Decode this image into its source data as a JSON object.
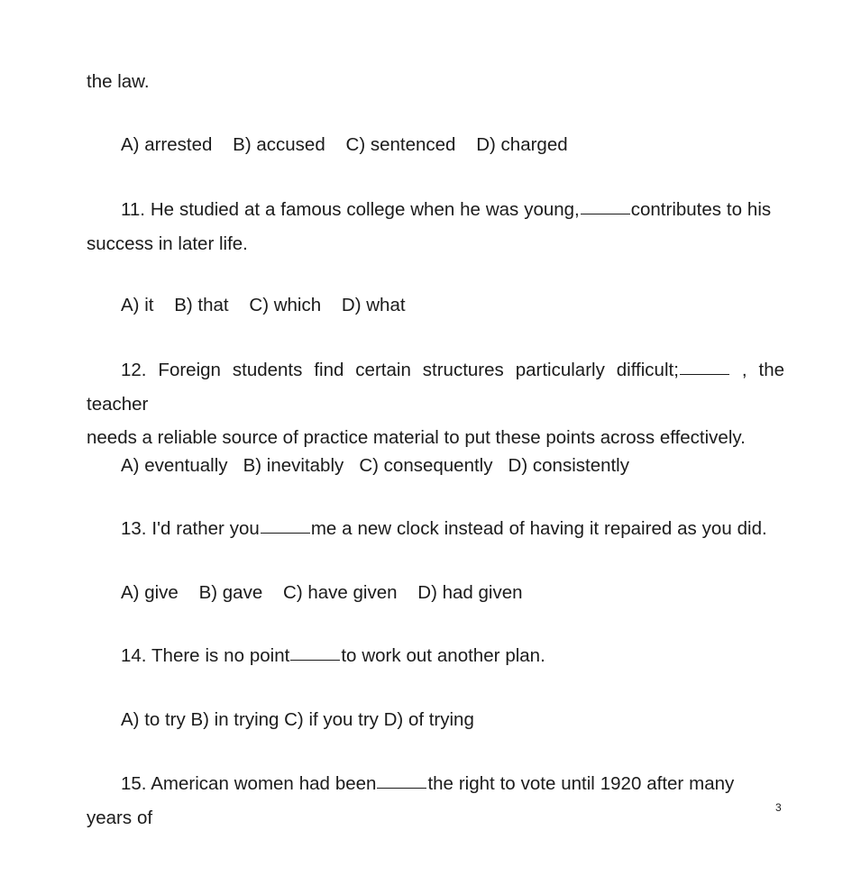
{
  "document": {
    "page_number": "3",
    "background_color": "#ffffff",
    "text_color": "#1b1b1b"
  },
  "blocks": [
    {
      "type": "continuation_line",
      "text": "the law."
    },
    {
      "type": "options",
      "text": "A) arrested    B) accused    C) sentenced    D) charged"
    },
    {
      "type": "question",
      "number": "11.",
      "text_before": "11. He studied at a famous college when he was young,",
      "text_after": "contributes to his",
      "wrap_line": "success in later life."
    },
    {
      "type": "options",
      "text": "A) it    B) that    C) which    D) what"
    },
    {
      "type": "question",
      "number": "12.",
      "text_before": "12. Foreign students find certain structures particularly difficult;",
      "text_after": ", the teacher",
      "wrap_line": "needs a reliable source of practice material to put these points across effectively."
    },
    {
      "type": "options",
      "text": "A) eventually   B) inevitably   C) consequently   D) consistently"
    },
    {
      "type": "question",
      "number": "13.",
      "text_before": "13. I'd rather you",
      "text_after": "me a new clock instead of having it repaired as you did."
    },
    {
      "type": "options",
      "text": "A) give    B) gave    C) have given    D) had given"
    },
    {
      "type": "question",
      "number": "14.",
      "text_before": "14. There is no point",
      "text_after": "to work out another plan."
    },
    {
      "type": "options",
      "text": "A) to try B) in trying C) if you try D) of trying"
    },
    {
      "type": "question",
      "number": "15.",
      "text_before": "15. American women had been",
      "text_after": "the right to vote until 1920 after many years of"
    }
  ]
}
